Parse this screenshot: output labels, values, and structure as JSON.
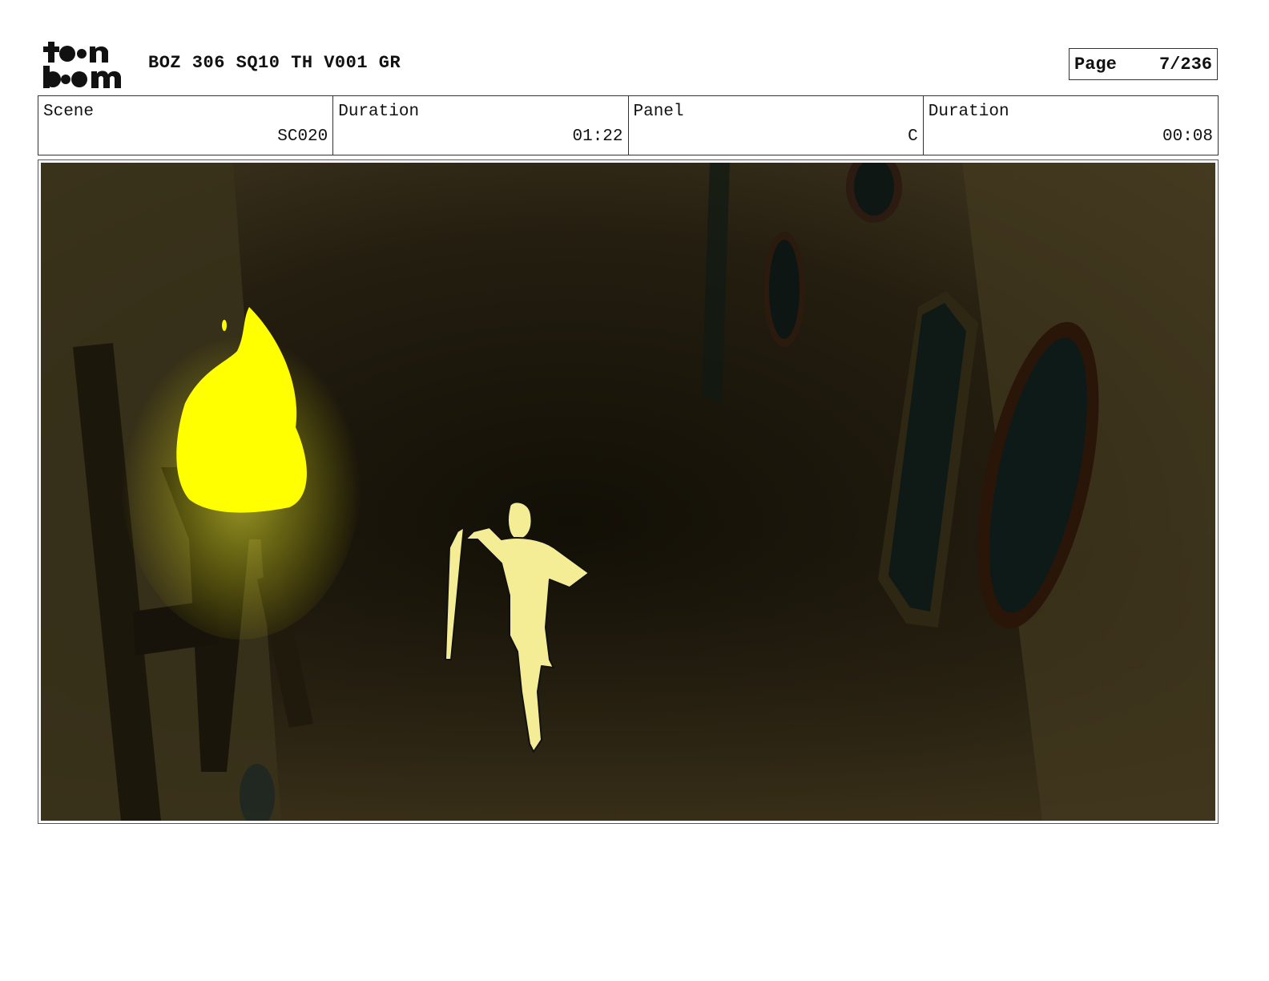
{
  "header": {
    "logo_text": "toon boom",
    "title": "BOZ 306 SQ10 TH V001 GR",
    "page_label": "Page",
    "page_value": "7/236"
  },
  "info": [
    {
      "label": "Scene",
      "value": "SC020"
    },
    {
      "label": "Duration",
      "value": "01:22"
    },
    {
      "label": "Panel",
      "value": "C"
    },
    {
      "label": "Duration",
      "value": "00:08"
    }
  ],
  "colors": {
    "flame": "#ffff00",
    "background_dark": "#1e1a0e",
    "character": "#f5ec96"
  }
}
